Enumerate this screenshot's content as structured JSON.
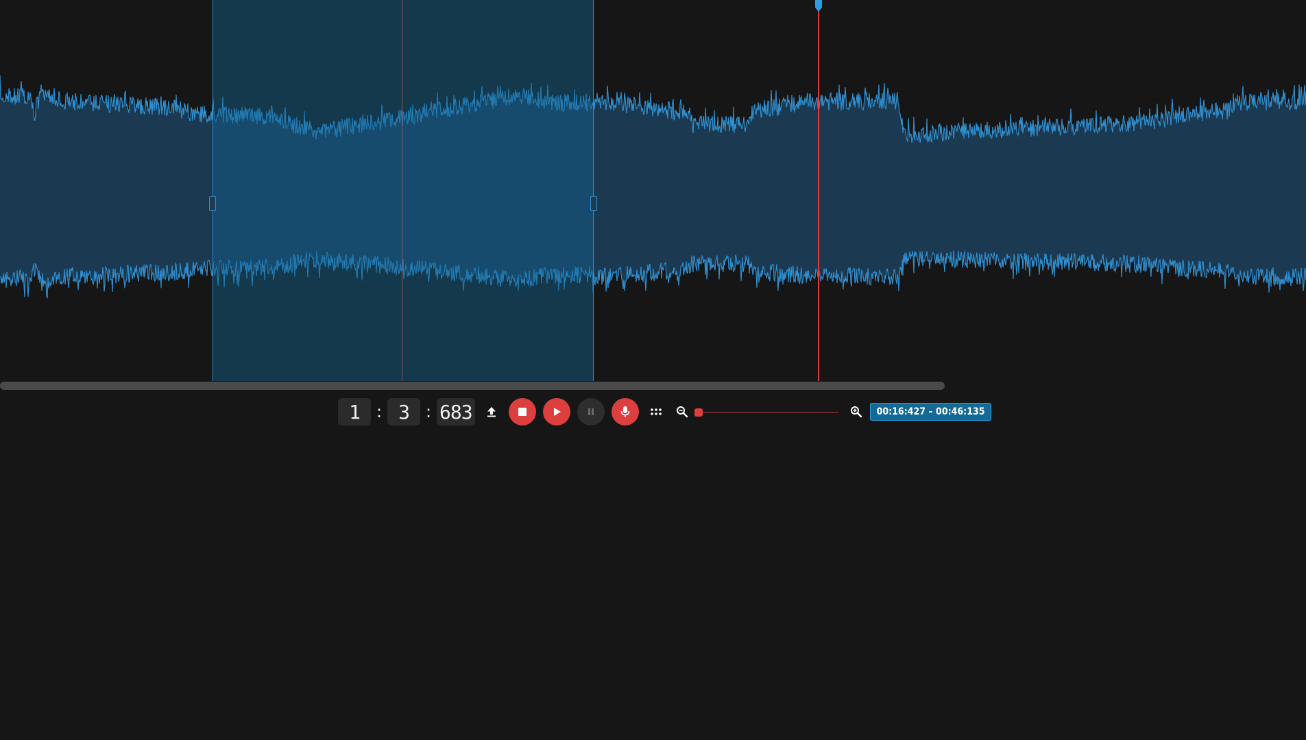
{
  "time": {
    "minutes": "1",
    "seconds": "3",
    "milliseconds": "683",
    "separator": ":"
  },
  "toolbar": {
    "buttons": [
      {
        "name": "upload",
        "icon": "upload-icon"
      },
      {
        "name": "stop",
        "icon": "stop-icon"
      },
      {
        "name": "play",
        "icon": "play-icon"
      },
      {
        "name": "pause",
        "icon": "pause-icon"
      },
      {
        "name": "record",
        "icon": "microphone-icon"
      },
      {
        "name": "more",
        "icon": "dots-grid-icon"
      },
      {
        "name": "zoom-out",
        "icon": "zoom-out-icon"
      },
      {
        "name": "zoom-in",
        "icon": "zoom-in-icon"
      }
    ],
    "zoom_level": 0.0
  },
  "selection": {
    "range_label": "00:16:427 – 00:46:135"
  },
  "colors": {
    "background": "#161616",
    "waveform": "#2f8fd0",
    "waveform_fill": "#1b3a52",
    "region": "#12628e",
    "cursor": "#e03a3a",
    "accent_red": "#dd3f3f",
    "badge": "#136a97"
  }
}
